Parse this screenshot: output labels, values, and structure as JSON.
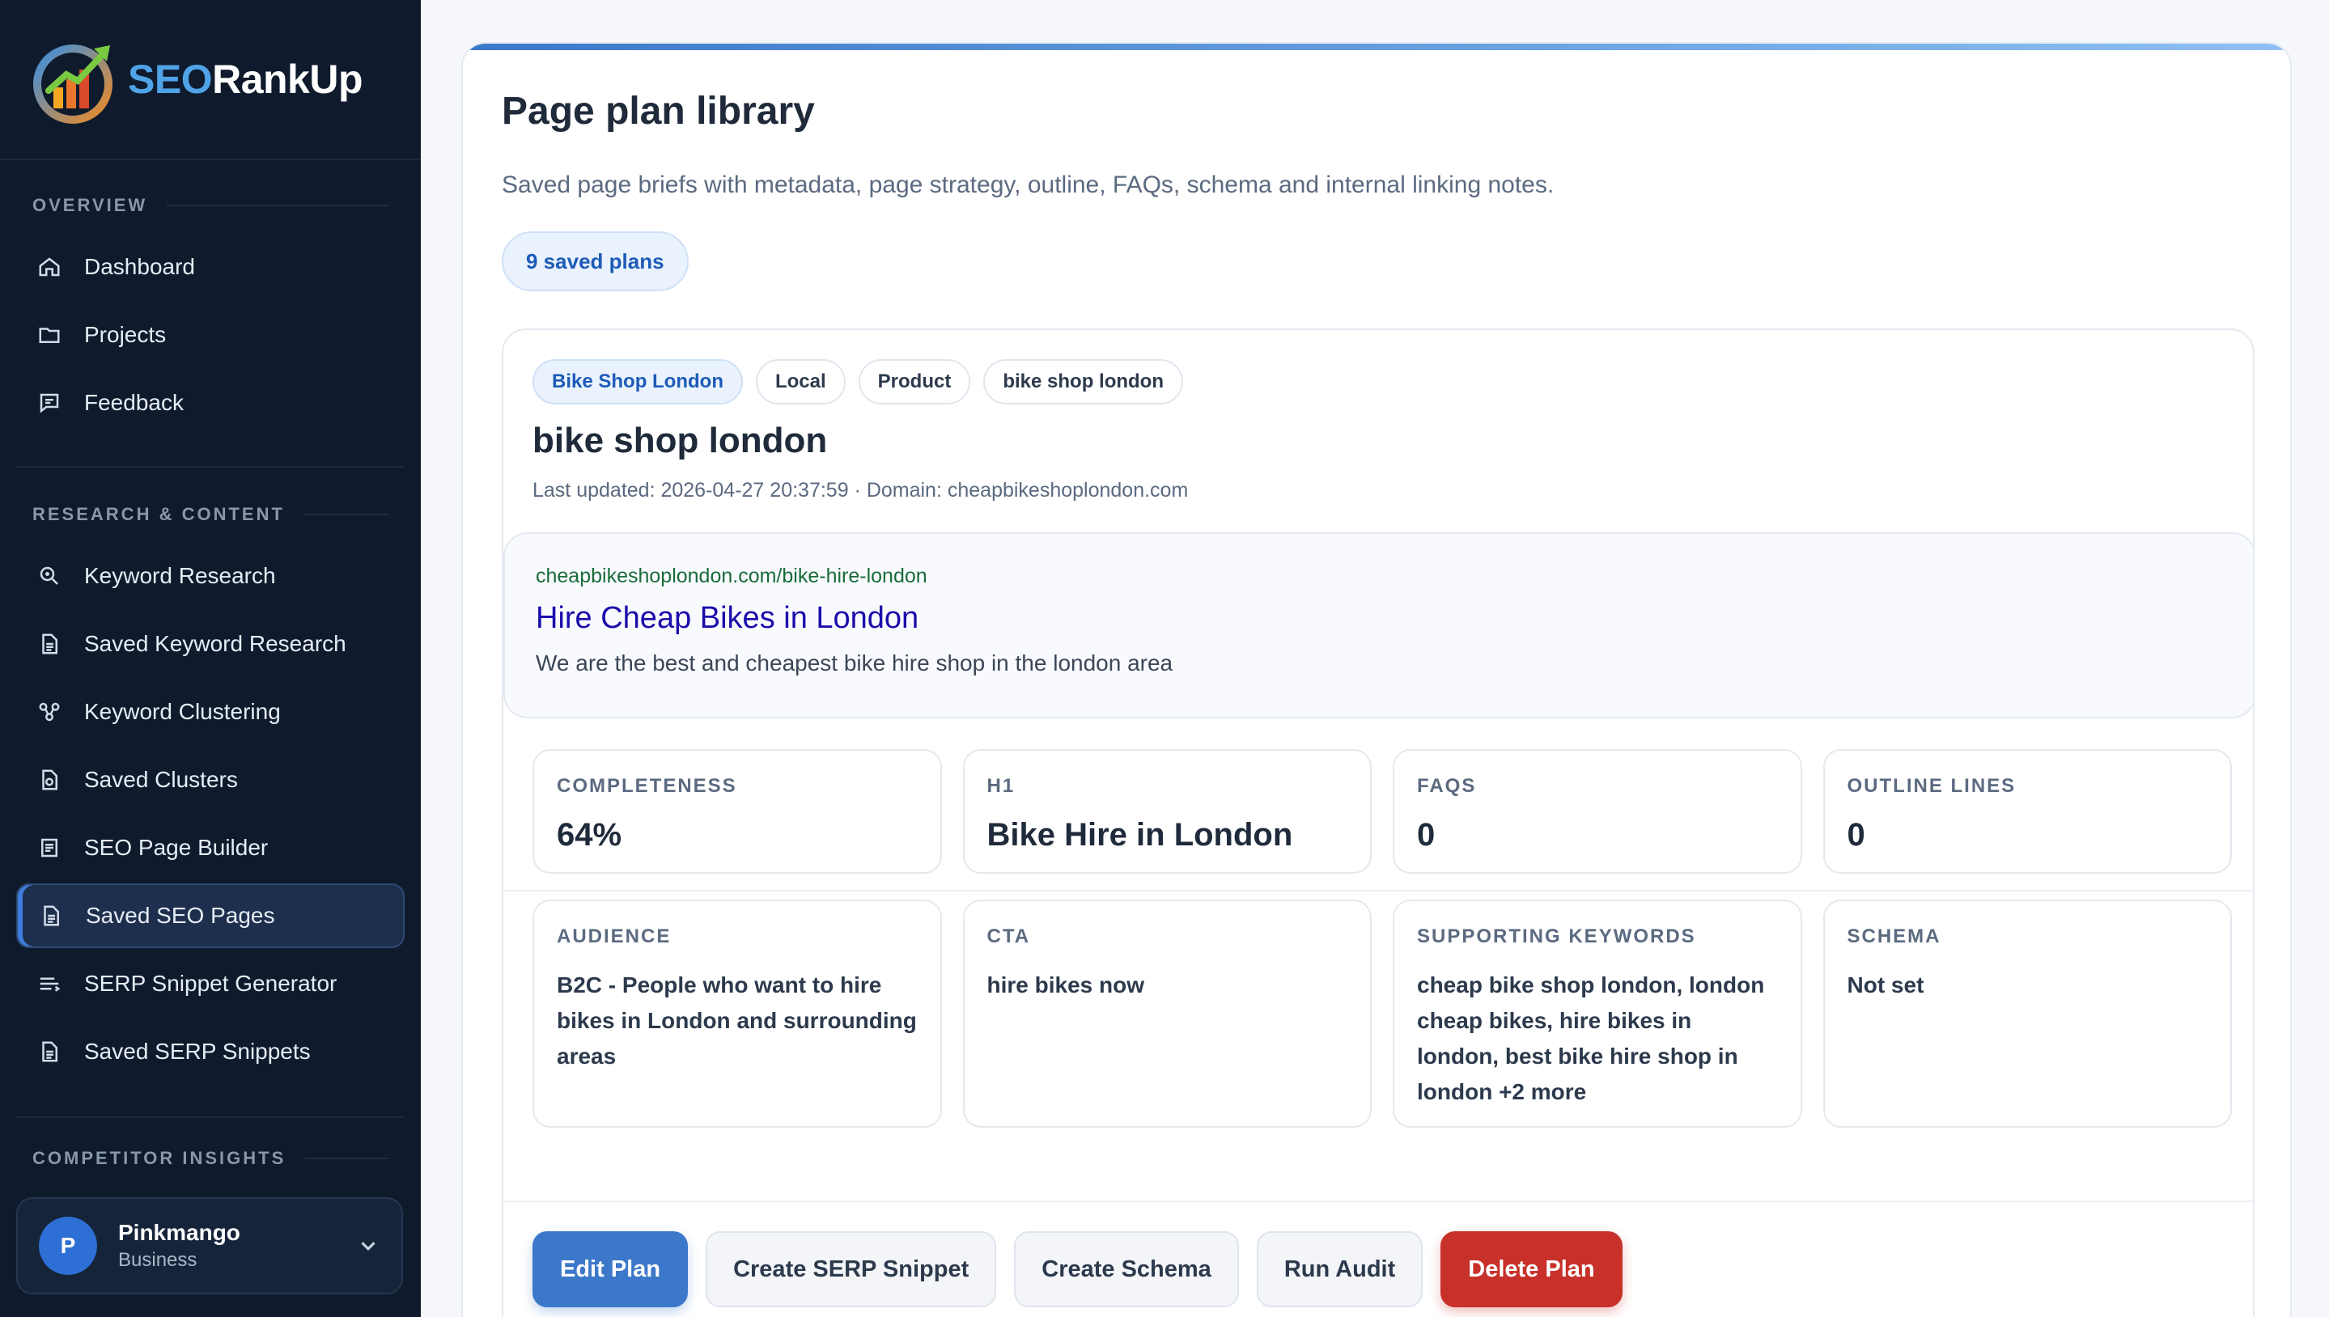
{
  "brand": {
    "part1": "SEO",
    "part2": "RankUp"
  },
  "sidebar": {
    "sections": [
      {
        "label": "OVERVIEW"
      },
      {
        "label": "RESEARCH & CONTENT"
      },
      {
        "label": "COMPETITOR INSIGHTS"
      }
    ],
    "overview_items": [
      {
        "label": "Dashboard",
        "icon": "home-icon"
      },
      {
        "label": "Projects",
        "icon": "folder-icon"
      },
      {
        "label": "Feedback",
        "icon": "chat-icon"
      }
    ],
    "research_items": [
      {
        "label": "Keyword Research",
        "icon": "search-icon"
      },
      {
        "label": "Saved Keyword Research",
        "icon": "document-icon"
      },
      {
        "label": "Keyword Clustering",
        "icon": "cluster-icon"
      },
      {
        "label": "Saved Clusters",
        "icon": "document-icon"
      },
      {
        "label": "SEO Page Builder",
        "icon": "document-icon"
      },
      {
        "label": "Saved SEO Pages",
        "icon": "document-icon",
        "active": true
      },
      {
        "label": "SERP Snippet Generator",
        "icon": "lines-icon"
      },
      {
        "label": "Saved SERP Snippets",
        "icon": "document-icon"
      }
    ],
    "user": {
      "initial": "P",
      "name": "Pinkmango",
      "plan": "Business"
    }
  },
  "main": {
    "title": "Page plan library",
    "subtitle": "Saved page briefs with metadata, page strategy, outline, FAQs, schema and internal linking notes.",
    "count_label": "9 saved plans",
    "plan": {
      "tags": [
        "Bike Shop London",
        "Local",
        "Product",
        "bike shop london"
      ],
      "title": "bike shop london",
      "meta": "Last updated: 2026-04-27 20:37:59 · Domain: cheapbikeshoplondon.com",
      "serp": {
        "url": "cheapbikeshoplondon.com/bike-hire-london",
        "title": "Hire Cheap Bikes in London",
        "description": "We are the best and cheapest bike hire shop in the london area"
      },
      "stats": {
        "completeness_label": "COMPLETENESS",
        "completeness_value": "64%",
        "h1_label": "H1",
        "h1_value": "Bike Hire in London",
        "faqs_label": "FAQS",
        "faqs_value": "0",
        "outline_label": "OUTLINE LINES",
        "outline_value": "0",
        "audience_label": "AUDIENCE",
        "audience_value": "B2C - People who want to hire bikes in London and surrounding areas",
        "cta_label": "CTA",
        "cta_value": "hire bikes now",
        "keywords_label": "SUPPORTING KEYWORDS",
        "keywords_value": "cheap bike shop london, london cheap bikes, hire bikes in london, best bike hire shop in london +2 more",
        "schema_label": "SCHEMA",
        "schema_value": "Not set"
      },
      "actions": {
        "edit": "Edit Plan",
        "serp": "Create SERP Snippet",
        "schema": "Create Schema",
        "audit": "Run Audit",
        "delete": "Delete Plan"
      }
    }
  },
  "colors": {
    "sidebar_bg": "#0f1b2d",
    "accent": "#3b78c9",
    "danger": "#c8302a",
    "serp_title": "#1a0dab",
    "serp_url": "#1a6b3a"
  }
}
